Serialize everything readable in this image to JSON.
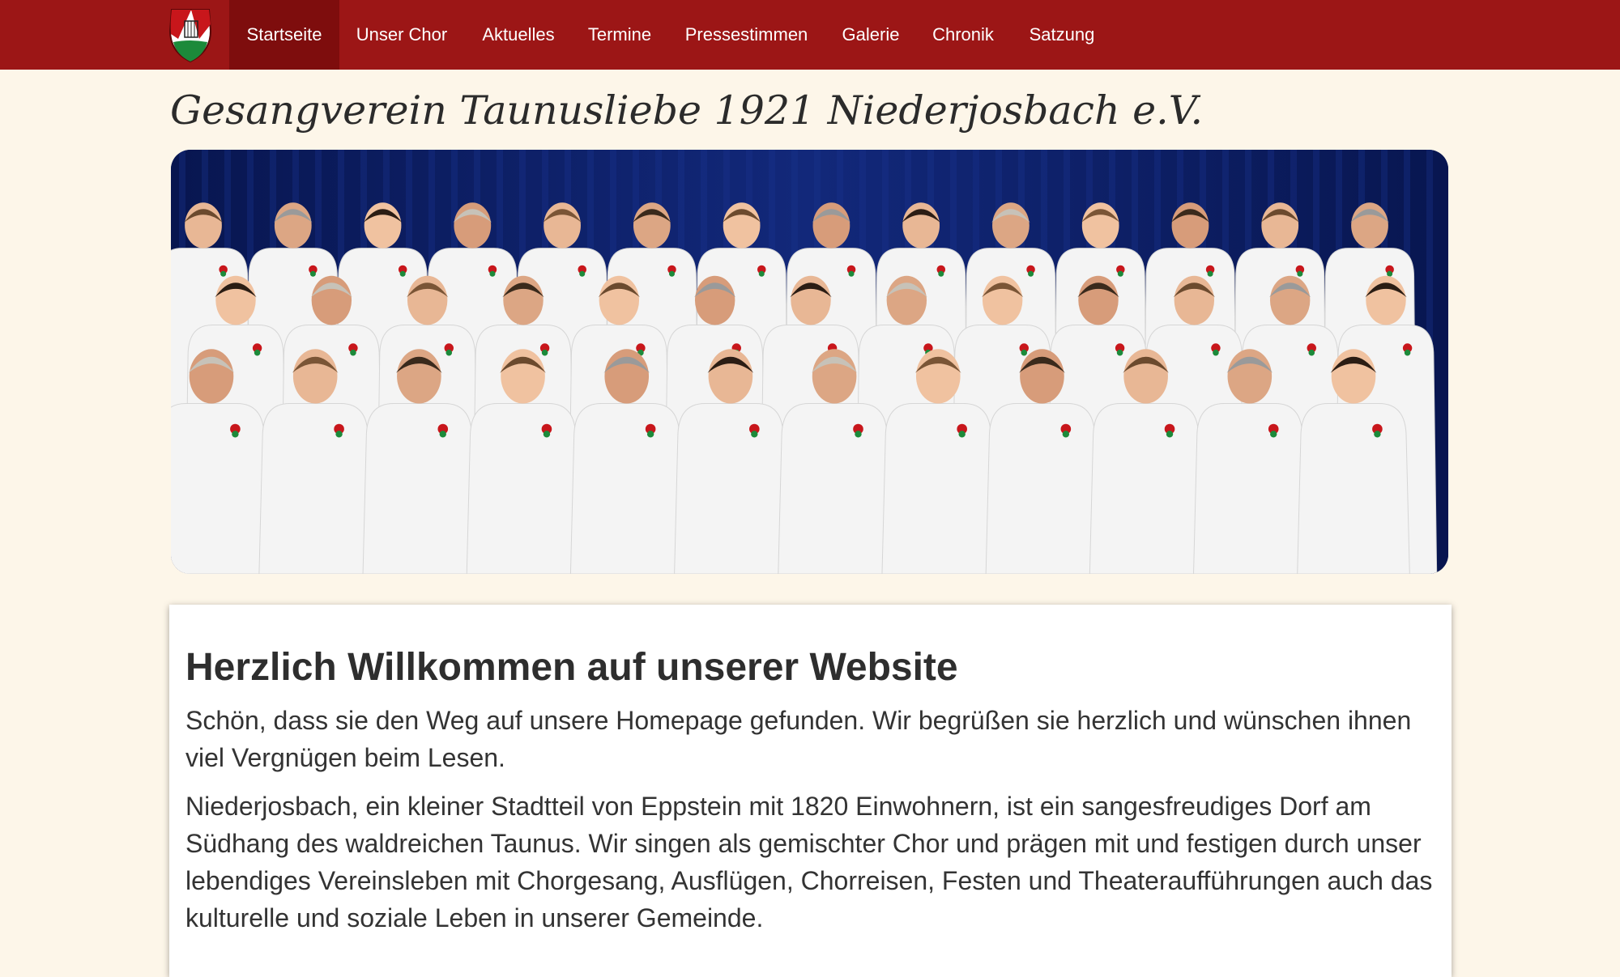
{
  "colors": {
    "navbar_bg": "#9c1616",
    "navbar_active_bg": "#7e0d0d",
    "page_bg": "#fdf6e9",
    "curtain_blue": "#0a1c5c",
    "shirt_white": "#f4f4f4"
  },
  "navbar": {
    "logo_icon": "club-crest-icon",
    "items": [
      {
        "label": "Startseite",
        "active": true
      },
      {
        "label": "Unser Chor",
        "active": false
      },
      {
        "label": "Aktuelles",
        "active": false
      },
      {
        "label": "Termine",
        "active": false
      },
      {
        "label": "Pressestimmen",
        "active": false
      },
      {
        "label": "Galerie",
        "active": false
      },
      {
        "label": "Chronik",
        "active": false
      },
      {
        "label": "Satzung",
        "active": false
      }
    ]
  },
  "header": {
    "site_title": "Gesangverein Taunusliebe 1921 Niederjosbach e.V."
  },
  "hero": {
    "image_icon": "choir-group-photo"
  },
  "main": {
    "heading": "Herzlich Willkommen auf unserer Website",
    "paragraphs": [
      "Schön, dass sie den Weg auf unsere Homepage gefunden. Wir begrüßen sie herzlich und wünschen ihnen viel Vergnügen beim Lesen.",
      "Niederjosbach, ein kleiner Stadtteil von Eppstein mit 1820 Einwohnern, ist ein sangesfreudiges Dorf am Südhang des waldreichen Taunus. Wir singen als gemischter Chor und prägen mit und festigen durch unser lebendiges Vereinsleben mit Chorgesang, Ausflügen, Chorreisen, Festen und Theateraufführungen auch das kulturelle und soziale Leben in unserer Gemeinde."
    ]
  }
}
